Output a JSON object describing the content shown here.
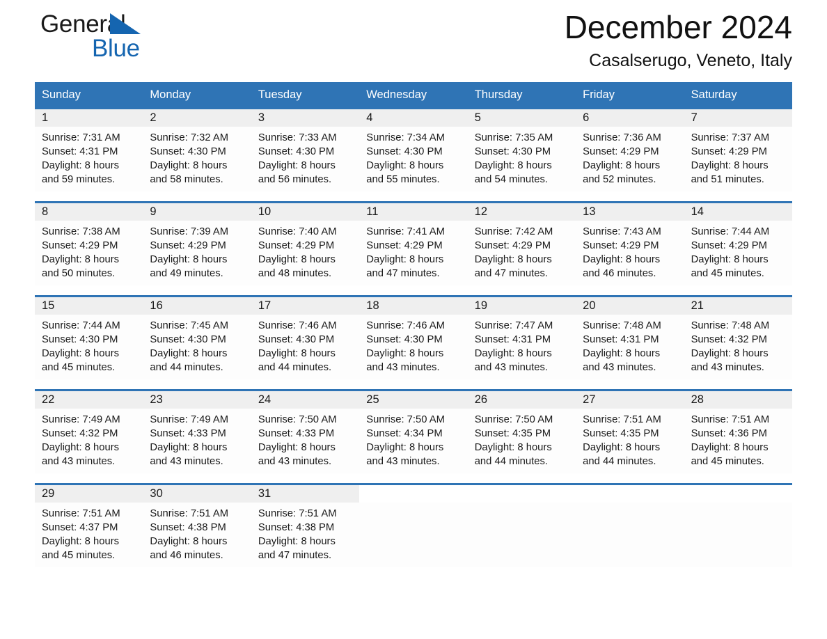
{
  "brand": {
    "word1": "General",
    "word2": "Blue",
    "triangle_color": "#1565b0",
    "word2_color": "#1565b0"
  },
  "header": {
    "title": "December 2024",
    "location": "Casalserugo, Veneto, Italy"
  },
  "theme": {
    "header_blue": "#2f74b5",
    "day_band_gray": "#efefef",
    "text": "#1a1a1a"
  },
  "weekdays": [
    "Sunday",
    "Monday",
    "Tuesday",
    "Wednesday",
    "Thursday",
    "Friday",
    "Saturday"
  ],
  "weeks": [
    [
      {
        "day": "1",
        "sunrise": "Sunrise: 7:31 AM",
        "sunset": "Sunset: 4:31 PM",
        "daylight1": "Daylight: 8 hours",
        "daylight2": "and 59 minutes."
      },
      {
        "day": "2",
        "sunrise": "Sunrise: 7:32 AM",
        "sunset": "Sunset: 4:30 PM",
        "daylight1": "Daylight: 8 hours",
        "daylight2": "and 58 minutes."
      },
      {
        "day": "3",
        "sunrise": "Sunrise: 7:33 AM",
        "sunset": "Sunset: 4:30 PM",
        "daylight1": "Daylight: 8 hours",
        "daylight2": "and 56 minutes."
      },
      {
        "day": "4",
        "sunrise": "Sunrise: 7:34 AM",
        "sunset": "Sunset: 4:30 PM",
        "daylight1": "Daylight: 8 hours",
        "daylight2": "and 55 minutes."
      },
      {
        "day": "5",
        "sunrise": "Sunrise: 7:35 AM",
        "sunset": "Sunset: 4:30 PM",
        "daylight1": "Daylight: 8 hours",
        "daylight2": "and 54 minutes."
      },
      {
        "day": "6",
        "sunrise": "Sunrise: 7:36 AM",
        "sunset": "Sunset: 4:29 PM",
        "daylight1": "Daylight: 8 hours",
        "daylight2": "and 52 minutes."
      },
      {
        "day": "7",
        "sunrise": "Sunrise: 7:37 AM",
        "sunset": "Sunset: 4:29 PM",
        "daylight1": "Daylight: 8 hours",
        "daylight2": "and 51 minutes."
      }
    ],
    [
      {
        "day": "8",
        "sunrise": "Sunrise: 7:38 AM",
        "sunset": "Sunset: 4:29 PM",
        "daylight1": "Daylight: 8 hours",
        "daylight2": "and 50 minutes."
      },
      {
        "day": "9",
        "sunrise": "Sunrise: 7:39 AM",
        "sunset": "Sunset: 4:29 PM",
        "daylight1": "Daylight: 8 hours",
        "daylight2": "and 49 minutes."
      },
      {
        "day": "10",
        "sunrise": "Sunrise: 7:40 AM",
        "sunset": "Sunset: 4:29 PM",
        "daylight1": "Daylight: 8 hours",
        "daylight2": "and 48 minutes."
      },
      {
        "day": "11",
        "sunrise": "Sunrise: 7:41 AM",
        "sunset": "Sunset: 4:29 PM",
        "daylight1": "Daylight: 8 hours",
        "daylight2": "and 47 minutes."
      },
      {
        "day": "12",
        "sunrise": "Sunrise: 7:42 AM",
        "sunset": "Sunset: 4:29 PM",
        "daylight1": "Daylight: 8 hours",
        "daylight2": "and 47 minutes."
      },
      {
        "day": "13",
        "sunrise": "Sunrise: 7:43 AM",
        "sunset": "Sunset: 4:29 PM",
        "daylight1": "Daylight: 8 hours",
        "daylight2": "and 46 minutes."
      },
      {
        "day": "14",
        "sunrise": "Sunrise: 7:44 AM",
        "sunset": "Sunset: 4:29 PM",
        "daylight1": "Daylight: 8 hours",
        "daylight2": "and 45 minutes."
      }
    ],
    [
      {
        "day": "15",
        "sunrise": "Sunrise: 7:44 AM",
        "sunset": "Sunset: 4:30 PM",
        "daylight1": "Daylight: 8 hours",
        "daylight2": "and 45 minutes."
      },
      {
        "day": "16",
        "sunrise": "Sunrise: 7:45 AM",
        "sunset": "Sunset: 4:30 PM",
        "daylight1": "Daylight: 8 hours",
        "daylight2": "and 44 minutes."
      },
      {
        "day": "17",
        "sunrise": "Sunrise: 7:46 AM",
        "sunset": "Sunset: 4:30 PM",
        "daylight1": "Daylight: 8 hours",
        "daylight2": "and 44 minutes."
      },
      {
        "day": "18",
        "sunrise": "Sunrise: 7:46 AM",
        "sunset": "Sunset: 4:30 PM",
        "daylight1": "Daylight: 8 hours",
        "daylight2": "and 43 minutes."
      },
      {
        "day": "19",
        "sunrise": "Sunrise: 7:47 AM",
        "sunset": "Sunset: 4:31 PM",
        "daylight1": "Daylight: 8 hours",
        "daylight2": "and 43 minutes."
      },
      {
        "day": "20",
        "sunrise": "Sunrise: 7:48 AM",
        "sunset": "Sunset: 4:31 PM",
        "daylight1": "Daylight: 8 hours",
        "daylight2": "and 43 minutes."
      },
      {
        "day": "21",
        "sunrise": "Sunrise: 7:48 AM",
        "sunset": "Sunset: 4:32 PM",
        "daylight1": "Daylight: 8 hours",
        "daylight2": "and 43 minutes."
      }
    ],
    [
      {
        "day": "22",
        "sunrise": "Sunrise: 7:49 AM",
        "sunset": "Sunset: 4:32 PM",
        "daylight1": "Daylight: 8 hours",
        "daylight2": "and 43 minutes."
      },
      {
        "day": "23",
        "sunrise": "Sunrise: 7:49 AM",
        "sunset": "Sunset: 4:33 PM",
        "daylight1": "Daylight: 8 hours",
        "daylight2": "and 43 minutes."
      },
      {
        "day": "24",
        "sunrise": "Sunrise: 7:50 AM",
        "sunset": "Sunset: 4:33 PM",
        "daylight1": "Daylight: 8 hours",
        "daylight2": "and 43 minutes."
      },
      {
        "day": "25",
        "sunrise": "Sunrise: 7:50 AM",
        "sunset": "Sunset: 4:34 PM",
        "daylight1": "Daylight: 8 hours",
        "daylight2": "and 43 minutes."
      },
      {
        "day": "26",
        "sunrise": "Sunrise: 7:50 AM",
        "sunset": "Sunset: 4:35 PM",
        "daylight1": "Daylight: 8 hours",
        "daylight2": "and 44 minutes."
      },
      {
        "day": "27",
        "sunrise": "Sunrise: 7:51 AM",
        "sunset": "Sunset: 4:35 PM",
        "daylight1": "Daylight: 8 hours",
        "daylight2": "and 44 minutes."
      },
      {
        "day": "28",
        "sunrise": "Sunrise: 7:51 AM",
        "sunset": "Sunset: 4:36 PM",
        "daylight1": "Daylight: 8 hours",
        "daylight2": "and 45 minutes."
      }
    ],
    [
      {
        "day": "29",
        "sunrise": "Sunrise: 7:51 AM",
        "sunset": "Sunset: 4:37 PM",
        "daylight1": "Daylight: 8 hours",
        "daylight2": "and 45 minutes."
      },
      {
        "day": "30",
        "sunrise": "Sunrise: 7:51 AM",
        "sunset": "Sunset: 4:38 PM",
        "daylight1": "Daylight: 8 hours",
        "daylight2": "and 46 minutes."
      },
      {
        "day": "31",
        "sunrise": "Sunrise: 7:51 AM",
        "sunset": "Sunset: 4:38 PM",
        "daylight1": "Daylight: 8 hours",
        "daylight2": "and 47 minutes."
      },
      {
        "day": "",
        "sunrise": "",
        "sunset": "",
        "daylight1": "",
        "daylight2": ""
      },
      {
        "day": "",
        "sunrise": "",
        "sunset": "",
        "daylight1": "",
        "daylight2": ""
      },
      {
        "day": "",
        "sunrise": "",
        "sunset": "",
        "daylight1": "",
        "daylight2": ""
      },
      {
        "day": "",
        "sunrise": "",
        "sunset": "",
        "daylight1": "",
        "daylight2": ""
      }
    ]
  ]
}
